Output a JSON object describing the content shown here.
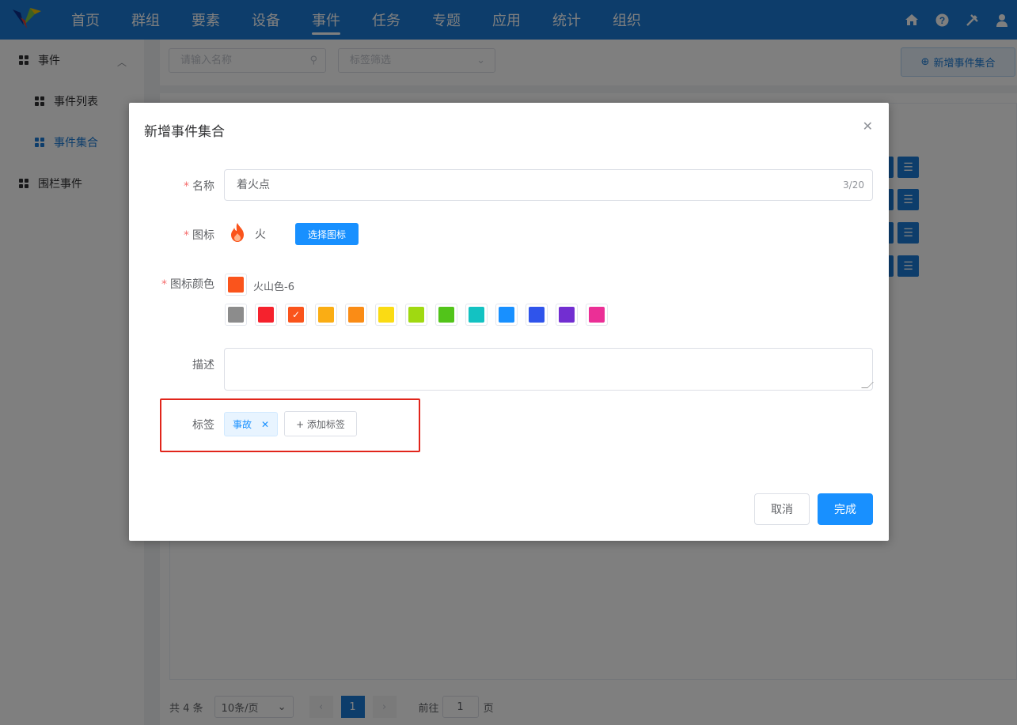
{
  "nav": {
    "items": [
      "首页",
      "群组",
      "要素",
      "设备",
      "事件",
      "任务",
      "专题",
      "应用",
      "统计",
      "组织"
    ],
    "active_index": 4,
    "right_icons": [
      "home-icon",
      "help-icon",
      "tools-icon",
      "user-icon"
    ]
  },
  "sidebar": {
    "group_label": "事件",
    "items": [
      {
        "label": "事件列表",
        "active": false
      },
      {
        "label": "事件集合",
        "active": true
      }
    ],
    "fence_label": "围栏事件"
  },
  "toolbar": {
    "search_placeholder": "请输入名称",
    "tag_filter_placeholder": "标签筛选",
    "add_button_label": "新增事件集合"
  },
  "pagination": {
    "total_label": "共 4 条",
    "page_size_label": "10条/页",
    "current_page": "1",
    "goto_prefix": "前往",
    "goto_value": "1",
    "goto_suffix": "页"
  },
  "dialog": {
    "title": "新增事件集合",
    "name_label": "名称",
    "name_value": "着火点",
    "name_count": "3/20",
    "icon_label": "图标",
    "icon_name": "火",
    "icon_symbol": "fire-icon",
    "choose_icon_label": "选择图标",
    "color_label": "图标颜色",
    "color_name": "火山色-6",
    "selected_color": "#fa541c",
    "swatches": [
      "#8c8c8c",
      "#f5222d",
      "#fa541c",
      "#faad14",
      "#fa8c16",
      "#fadb14",
      "#a0d911",
      "#52c41a",
      "#13c2c2",
      "#1890ff",
      "#2f54eb",
      "#722ed1",
      "#eb2f96"
    ],
    "selected_swatch_index": 2,
    "desc_label": "描述",
    "tags_label": "标签",
    "tags": [
      "事故"
    ],
    "add_tag_label": "+ 添加标签",
    "cancel_label": "取消",
    "ok_label": "完成"
  }
}
